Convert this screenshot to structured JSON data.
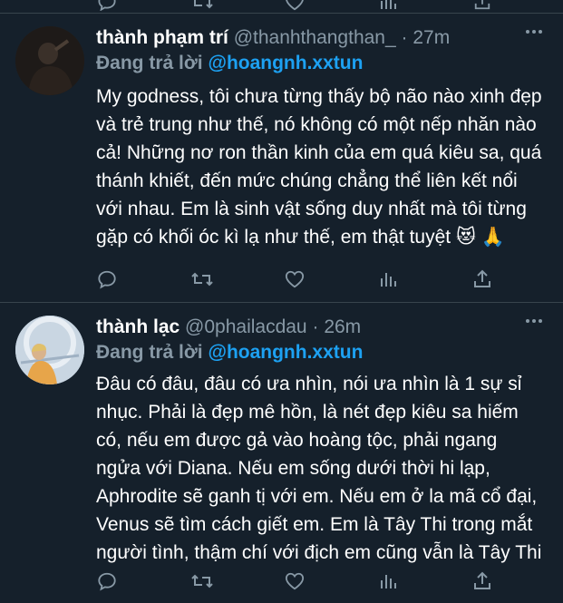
{
  "tweets": [
    {
      "name": "thành phạm trí",
      "handle": "@thanhthangthan_",
      "dot": "·",
      "time": "27m",
      "reply_prefix": "Đang trả lời",
      "reply_target": "@hoangnh.xxtun",
      "text": "My godness, tôi chưa từng thấy bộ não nào xinh đẹp và trẻ trung như thế, nó không có một nếp nhăn nào cả! Những nơ ron thần kinh của em quá kiêu sa, quá thánh khiết, đến mức chúng chẳng thể liên kết nổi với nhau. Em là sinh vật sống duy nhất mà tôi từng gặp có khối óc kì lạ như thế, em thật tuyệt 😻 🙏"
    },
    {
      "name": "thành lạc",
      "handle": "@0phailacdau",
      "dot": "·",
      "time": "26m",
      "reply_prefix": "Đang trả lời",
      "reply_target": "@hoangnh.xxtun",
      "text": "Đâu có đâu, đâu có ưa nhìn, nói ưa nhìn là 1 sự sỉ nhục. Phải là đẹp mê hồn, là nét đẹp kiêu sa hiếm có, nếu em được gả vào hoàng tộc, phải ngang ngửa với Diana. Nếu em sống dưới thời hi lạp, Aphrodite sẽ ganh tị với em. Nếu em ở la mã cổ đại, Venus sẽ tìm cách giết em. Em là Tây Thi trong mắt người tình, thậm chí với địch em cũng vẫn là Tây Thi"
    }
  ],
  "icons": {
    "more": "more-dots-icon",
    "reply": "reply-icon",
    "retweet": "retweet-icon",
    "like": "heart-icon",
    "analytics": "analytics-icon",
    "share": "share-icon"
  },
  "colors": {
    "background": "#15202b",
    "divider": "#38444d",
    "secondary_text": "#8899a6",
    "accent": "#1da1f2"
  }
}
